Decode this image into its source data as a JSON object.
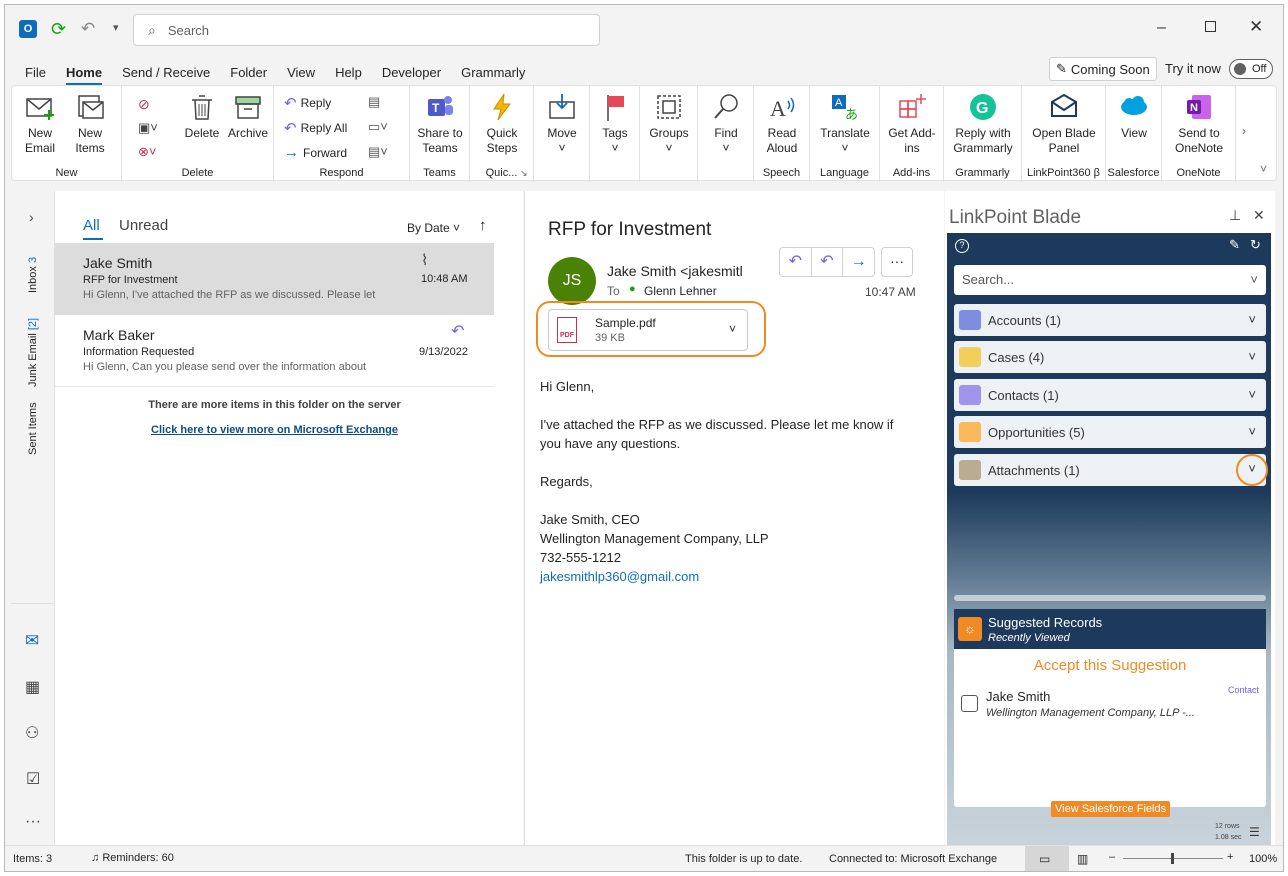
{
  "titlebar": {
    "search_placeholder": "Search",
    "coming_soon": "Coming Soon",
    "try_it_now": "Try it now",
    "toggle": "Off"
  },
  "menu": [
    "File",
    "Home",
    "Send / Receive",
    "Folder",
    "View",
    "Help",
    "Developer",
    "Grammarly"
  ],
  "ribbon": {
    "new": {
      "label": "New",
      "new_email": "New\nEmail",
      "new_items": "New\nItems"
    },
    "delete": {
      "label": "Delete",
      "delete": "Delete",
      "archive": "Archive"
    },
    "respond": {
      "label": "Respond",
      "reply": "Reply",
      "reply_all": "Reply All",
      "forward": "Forward"
    },
    "teams": {
      "label": "Teams",
      "share": "Share to Teams"
    },
    "quick": {
      "label": "Quic...",
      "steps": "Quick Steps"
    },
    "move": {
      "move": "Move"
    },
    "tags": {
      "tags": "Tags"
    },
    "groups": {
      "groups": "Groups"
    },
    "find": {
      "find": "Find"
    },
    "speech": {
      "label": "Speech",
      "read": "Read Aloud"
    },
    "language": {
      "label": "Language",
      "translate": "Translate"
    },
    "addins": {
      "label": "Add-ins",
      "get": "Get Add-ins"
    },
    "grammarly": {
      "label": "Grammarly",
      "reply": "Reply with Grammarly"
    },
    "linkpoint": {
      "label": "LinkPoint360 β",
      "open": "Open Blade Panel"
    },
    "salesforce": {
      "label": "Salesforce",
      "view": "View"
    },
    "onenote": {
      "label": "OneNote",
      "send": "Send to OneNote"
    }
  },
  "leftnav": {
    "inbox": "Inbox",
    "inbox_count": "3",
    "junk": "Junk Email",
    "junk_count": "[2]",
    "sent": "Sent Items"
  },
  "list": {
    "tabs": {
      "all": "All",
      "unread": "Unread"
    },
    "sort": "By Date",
    "items": [
      {
        "sender": "Jake Smith",
        "subject": "RFP for Investment",
        "preview": "Hi Glenn,  I've attached the RFP as we discussed. Please let",
        "time": "10:48 AM"
      },
      {
        "sender": "Mark Baker",
        "subject": "Information Requested",
        "preview": "Hi Glenn,  Can you please send over the information about",
        "time": "9/13/2022"
      }
    ],
    "more_text": "There are more items in this folder on the server",
    "more_link": "Click here to view more on Microsoft Exchange"
  },
  "reading": {
    "subject": "RFP for Investment",
    "initials": "JS",
    "from": "Jake Smith <jakesmitl",
    "to_label": "To",
    "to": "Glenn Lehner",
    "time": "10:47 AM",
    "attachment_name": "Sample.pdf",
    "attachment_size": "39 KB",
    "body": [
      "Hi Glenn,",
      "I've attached the RFP as we discussed. Please let me know if you have any questions.",
      "Regards,"
    ],
    "sig": [
      "Jake Smith, CEO",
      "Wellington Management Company, LLP",
      "732-555-1212"
    ],
    "email": "jakesmithlp360@gmail.com"
  },
  "blade": {
    "title": "LinkPoint Blade",
    "search_placeholder": "Search...",
    "sections": [
      "Accounts (1)",
      "Cases (4)",
      "Contacts (1)",
      "Opportunities (5)",
      "Attachments (1)"
    ],
    "suggested_title": "Suggested Records",
    "suggested_sub": "Recently Viewed",
    "accept": "Accept this Suggestion",
    "record_name": "Jake Smith",
    "record_company": "Wellington Management Company, LLP -...",
    "record_type": "Contact",
    "view_fields": "View Salesforce Fields",
    "rows": "12 rows",
    "secs": "1.08 sec"
  },
  "status": {
    "items": "Items: 3",
    "reminders": "Reminders: 60",
    "uptodate": "This folder is up to date.",
    "connected": "Connected to: Microsoft Exchange",
    "zoom": "100%"
  }
}
